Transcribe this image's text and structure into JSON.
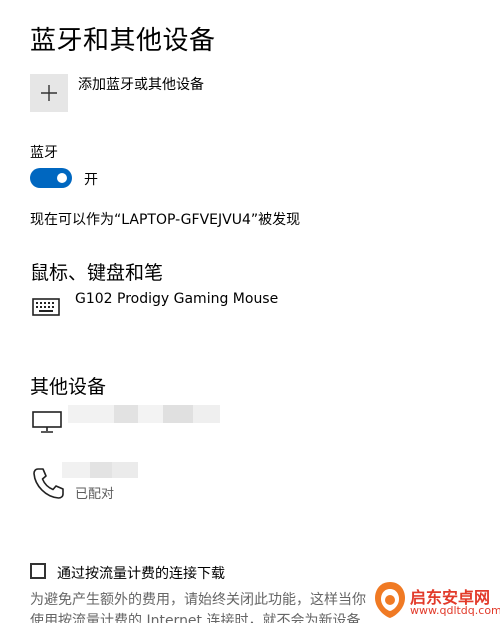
{
  "page": {
    "title": "蓝牙和其他设备"
  },
  "add_device": {
    "label": "添加蓝牙或其他设备",
    "icon": "plus-icon"
  },
  "bluetooth": {
    "label": "蓝牙",
    "toggle_state": "开",
    "toggle_on": true,
    "accent_color": "#0067c0",
    "discoverable_text": "现在可以作为“LAPTOP-GFVEJVU4”被发现"
  },
  "mouse_keyboard_pen": {
    "heading": "鼠标、键盘和笔",
    "devices": [
      {
        "name": "G102 Prodigy Gaming Mouse",
        "icon": "keyboard-icon"
      }
    ]
  },
  "other_devices": {
    "heading": "其他设备",
    "devices": [
      {
        "name": "",
        "icon": "monitor-icon",
        "status": ""
      },
      {
        "name": "",
        "icon": "phone-icon",
        "status": "已配对"
      }
    ]
  },
  "metered": {
    "checkbox_label": "通过按流量计费的连接下载",
    "checked": false,
    "description": "为避免产生额外的费用，请始终关闭此功能，这样当你使用按流量计费的 Internet 连接时，就不会为新设备下载相关的"
  },
  "watermark": {
    "title": "启东安卓网",
    "url": "www.qdltdq.com"
  }
}
